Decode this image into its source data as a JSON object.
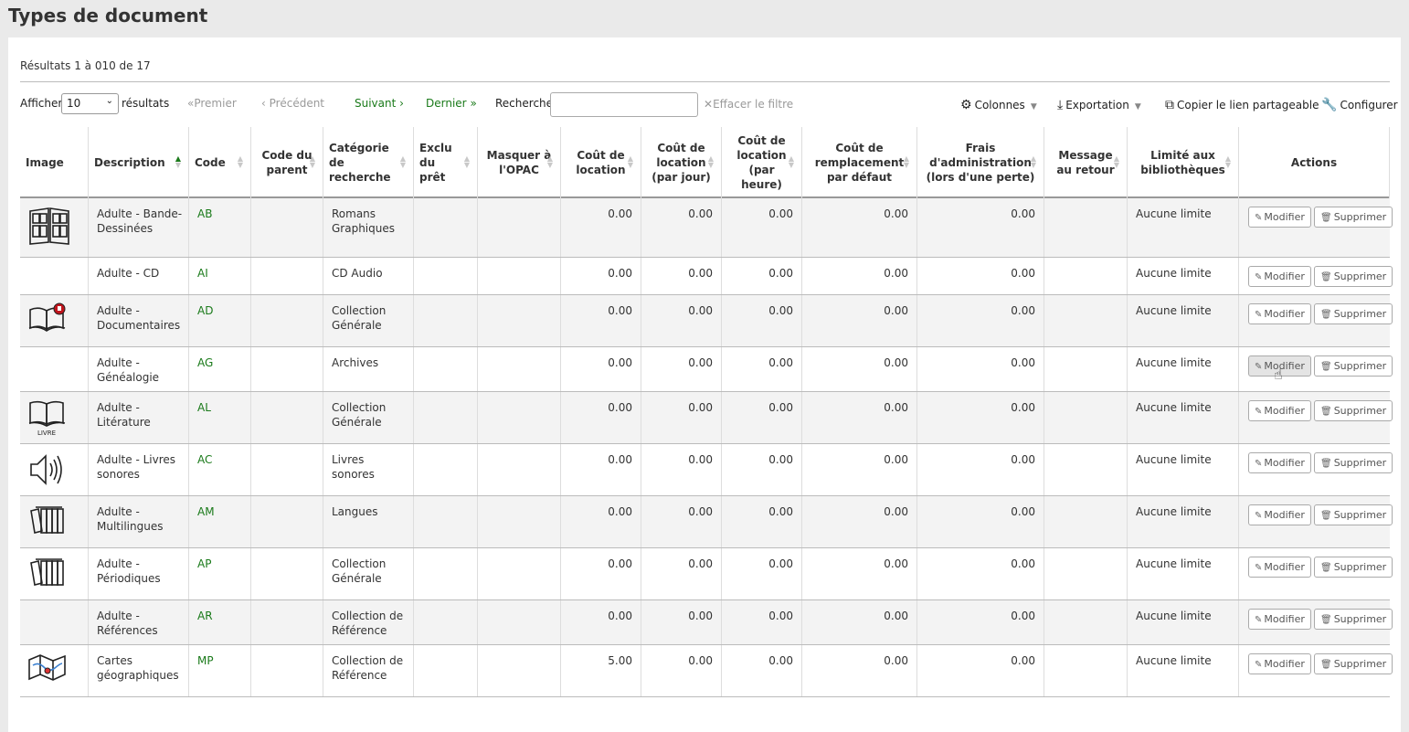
{
  "page": {
    "title": "Types de document"
  },
  "results_info": "Résultats 1 à 010 de 17",
  "toolbar": {
    "show_label": "Afficher",
    "length_value": "10",
    "results_label": "résultats",
    "first": "Premier",
    "previous": "Précédent",
    "next": "Suivant",
    "last": "Dernier",
    "search_label": "Rechercher :",
    "search_value": "",
    "clear_filter": "Effacer le filtre",
    "columns": "Colonnes",
    "export": "Exportation",
    "copy_link": "Copier le lien partageable",
    "configure": "Configurer"
  },
  "columns": [
    "Image",
    "Description",
    "Code",
    "Code du parent",
    "Catégorie de recherche",
    "Exclu du prêt",
    "Masquer à l'OPAC",
    "Coût de location",
    "Coût de location (par jour)",
    "Coût de location (par heure)",
    "Coût de remplacement par défaut",
    "Frais d'administration (lors d'une perte)",
    "Message au retour",
    "Limité aux bibliothèques",
    "Actions"
  ],
  "actions": {
    "edit": "Modifier",
    "delete": "Supprimer"
  },
  "rows": [
    {
      "icon": "comic-book-icon",
      "description": "Adulte - Bande-Dessinées",
      "code": "AB",
      "parent": "",
      "category": "Romans Graphiques",
      "notforloan": "",
      "hide_opac": "",
      "rental": "0.00",
      "rental_day": "0.00",
      "rental_hour": "0.00",
      "replacement": "0.00",
      "processing_fee": "0.00",
      "checkin_msg": "",
      "limit": "Aucune limite"
    },
    {
      "icon": "",
      "description": "Adulte - CD",
      "code": "AI",
      "parent": "",
      "category": "CD Audio",
      "notforloan": "",
      "hide_opac": "",
      "rental": "0.00",
      "rental_day": "0.00",
      "rental_hour": "0.00",
      "replacement": "0.00",
      "processing_fee": "0.00",
      "checkin_msg": "",
      "limit": "Aucune limite"
    },
    {
      "icon": "reference-book-icon",
      "description": "Adulte - Documentaires",
      "code": "AD",
      "parent": "",
      "category": "Collection Générale",
      "notforloan": "",
      "hide_opac": "",
      "rental": "0.00",
      "rental_day": "0.00",
      "rental_hour": "0.00",
      "replacement": "0.00",
      "processing_fee": "0.00",
      "checkin_msg": "",
      "limit": "Aucune limite"
    },
    {
      "icon": "",
      "description": "Adulte - Généalogie",
      "code": "AG",
      "parent": "",
      "category": "Archives",
      "notforloan": "",
      "hide_opac": "",
      "rental": "0.00",
      "rental_day": "0.00",
      "rental_hour": "0.00",
      "replacement": "0.00",
      "processing_fee": "0.00",
      "checkin_msg": "",
      "limit": "Aucune limite"
    },
    {
      "icon": "open-book-icon",
      "icon_caption": "LIVRE",
      "description": "Adulte - Litérature",
      "code": "AL",
      "parent": "",
      "category": "Collection Générale",
      "notforloan": "",
      "hide_opac": "",
      "rental": "0.00",
      "rental_day": "0.00",
      "rental_hour": "0.00",
      "replacement": "0.00",
      "processing_fee": "0.00",
      "checkin_msg": "",
      "limit": "Aucune limite"
    },
    {
      "icon": "speaker-icon",
      "description": "Adulte - Livres sonores",
      "code": "AC",
      "parent": "",
      "category": "Livres sonores",
      "notforloan": "",
      "hide_opac": "",
      "rental": "0.00",
      "rental_day": "0.00",
      "rental_hour": "0.00",
      "replacement": "0.00",
      "processing_fee": "0.00",
      "checkin_msg": "",
      "limit": "Aucune limite"
    },
    {
      "icon": "books-stack-icon",
      "description": "Adulte - Multilingues",
      "code": "AM",
      "parent": "",
      "category": "Langues",
      "notforloan": "",
      "hide_opac": "",
      "rental": "0.00",
      "rental_day": "0.00",
      "rental_hour": "0.00",
      "replacement": "0.00",
      "processing_fee": "0.00",
      "checkin_msg": "",
      "limit": "Aucune limite"
    },
    {
      "icon": "books-stack-icon",
      "description": "Adulte - Périodiques",
      "code": "AP",
      "parent": "",
      "category": "Collection Générale",
      "notforloan": "",
      "hide_opac": "",
      "rental": "0.00",
      "rental_day": "0.00",
      "rental_hour": "0.00",
      "replacement": "0.00",
      "processing_fee": "0.00",
      "checkin_msg": "",
      "limit": "Aucune limite"
    },
    {
      "icon": "",
      "description": "Adulte - Références",
      "code": "AR",
      "parent": "",
      "category": "Collection de Référence",
      "notforloan": "",
      "hide_opac": "",
      "rental": "0.00",
      "rental_day": "0.00",
      "rental_hour": "0.00",
      "replacement": "0.00",
      "processing_fee": "0.00",
      "checkin_msg": "",
      "limit": "Aucune limite"
    },
    {
      "icon": "map-icon",
      "description": "Cartes géographiques",
      "code": "MP",
      "parent": "",
      "category": "Collection de Référence",
      "notforloan": "",
      "hide_opac": "",
      "rental": "5.00",
      "rental_day": "0.00",
      "rental_hour": "0.00",
      "replacement": "0.00",
      "processing_fee": "0.00",
      "checkin_msg": "",
      "limit": "Aucune limite"
    }
  ]
}
